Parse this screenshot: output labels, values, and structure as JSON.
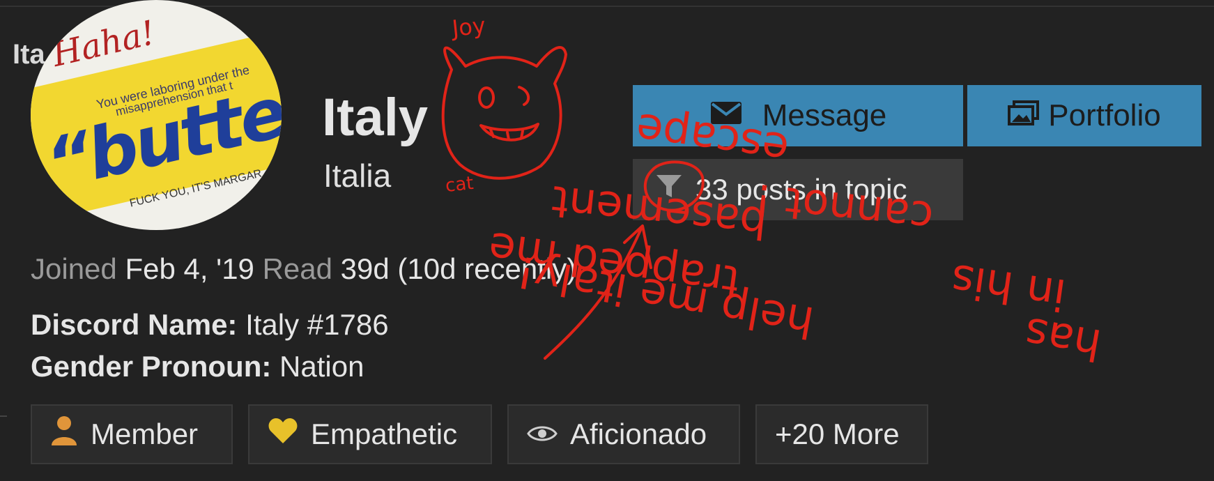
{
  "profile": {
    "cut_tab_text": "Ita",
    "name": "Italy",
    "subname": "Italia",
    "avatar": {
      "haha": "Haha!",
      "line1": "You were laboring under the",
      "line2": "misapprehension that t",
      "butter": "“butte",
      "fuck": "FUCK YOU, IT'S MARGAR"
    }
  },
  "actions": {
    "message_label": "Message",
    "portfolio_label": "Portfolio",
    "posts_label": "33 posts in topic",
    "message_icon": "envelope-icon",
    "portfolio_icon": "images-icon",
    "filter_icon": "filter-icon"
  },
  "stats": {
    "joined_label": "Joined",
    "joined_value": "Feb 4, '19",
    "read_label": "Read",
    "read_value": "39d (10d recently)"
  },
  "fields": [
    {
      "label": "Discord Name:",
      "value": "Italy #1786"
    },
    {
      "label": "Gender Pronoun:",
      "value": "Nation"
    }
  ],
  "badges": [
    {
      "label": "Member",
      "icon": "person-icon",
      "color": "#e0953a"
    },
    {
      "label": "Empathetic",
      "icon": "heart-icon",
      "color": "#e8c12a"
    },
    {
      "label": "Aficionado",
      "icon": "eye-icon",
      "color": "#cfcfcf"
    },
    {
      "label": "+20 More",
      "icon": "",
      "color": ""
    }
  ],
  "annotations": {
    "joy": "Joy",
    "cat": "cat",
    "line1": "escape",
    "line2": "cannot !",
    "line3": "basement",
    "line4": "in his",
    "line5": "trapped me",
    "line6": "has",
    "line7": "help me italy!"
  },
  "colors": {
    "background": "#222222",
    "accent": "#3a86b3",
    "scribble": "#e12318"
  }
}
